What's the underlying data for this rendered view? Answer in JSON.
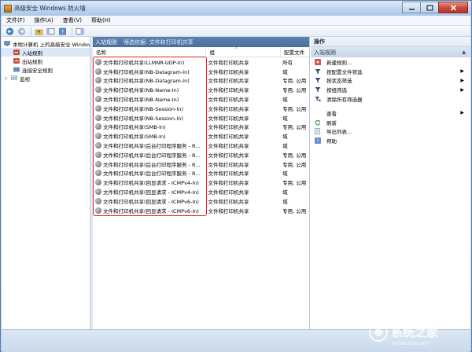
{
  "window": {
    "title": "高级安全 Windows 防火墙"
  },
  "menu": [
    "文件(F)",
    "操作(A)",
    "查看(V)",
    "帮助(H)"
  ],
  "tree": {
    "root": "本地计算机 上的高级安全 Windows 防火墙",
    "items": [
      "入站规则",
      "出站规则",
      "连接安全规则",
      "监视"
    ]
  },
  "center": {
    "title": "入站规则",
    "filter": "筛选依据: 文件和打印机共享",
    "columns": {
      "name": "名称",
      "group": "组",
      "profile": "配置文件"
    },
    "rows": [
      {
        "name": "文件和打印机共享(LLMNR-UDP-In)",
        "group": "文件和打印机共享",
        "profile": "所有"
      },
      {
        "name": "文件和打印机共享(NB-Datagram-In)",
        "group": "文件和打印机共享",
        "profile": "域"
      },
      {
        "name": "文件和打印机共享(NB-Datagram-In)",
        "group": "文件和打印机共享",
        "profile": "专用, 公用"
      },
      {
        "name": "文件和打印机共享(NB-Name-In)",
        "group": "文件和打印机共享",
        "profile": "专用, 公用"
      },
      {
        "name": "文件和打印机共享(NB-Name-In)",
        "group": "文件和打印机共享",
        "profile": "域"
      },
      {
        "name": "文件和打印机共享(NB-Session-In)",
        "group": "文件和打印机共享",
        "profile": "专用, 公用"
      },
      {
        "name": "文件和打印机共享(NB-Session-In)",
        "group": "文件和打印机共享",
        "profile": "域"
      },
      {
        "name": "文件和打印机共享(SMB-In)",
        "group": "文件和打印机共享",
        "profile": "专用, 公用"
      },
      {
        "name": "文件和打印机共享(SMB-In)",
        "group": "文件和打印机共享",
        "profile": "域"
      },
      {
        "name": "文件和打印机共享(后台打印程序服务 - R...",
        "group": "文件和打印机共享",
        "profile": "域"
      },
      {
        "name": "文件和打印机共享(后台打印程序服务 - R...",
        "group": "文件和打印机共享",
        "profile": "专用, 公用"
      },
      {
        "name": "文件和打印机共享(后台打印程序服务 - R...",
        "group": "文件和打印机共享",
        "profile": "专用, 公用"
      },
      {
        "name": "文件和打印机共享(后台打印程序服务 - R...",
        "group": "文件和打印机共享",
        "profile": "域"
      },
      {
        "name": "文件和打印机共享(回显请求 - ICMPv4-In)",
        "group": "文件和打印机共享",
        "profile": "专用, 公用"
      },
      {
        "name": "文件和打印机共享(回显请求 - ICMPv4-In)",
        "group": "文件和打印机共享",
        "profile": "域"
      },
      {
        "name": "文件和打印机共享(回显请求 - ICMPv6-In)",
        "group": "文件和打印机共享",
        "profile": "域"
      },
      {
        "name": "文件和打印机共享(回显请求 - ICMPv6-In)",
        "group": "文件和打印机共享",
        "profile": "专用, 公用"
      }
    ]
  },
  "actions": {
    "title": "操作",
    "section": "入站规则",
    "items": [
      {
        "label": "新建规则...",
        "icon": "new-rule-icon",
        "submenu": false
      },
      {
        "label": "按配置文件筛选",
        "icon": "filter-icon",
        "submenu": true
      },
      {
        "label": "按状态筛选",
        "icon": "filter-icon",
        "submenu": true
      },
      {
        "label": "按组筛选",
        "icon": "filter-icon",
        "submenu": true
      },
      {
        "label": "清除所有筛选器",
        "icon": "clear-filter-icon",
        "submenu": false
      },
      {
        "label": "查看",
        "icon": "",
        "submenu": true
      },
      {
        "label": "刷新",
        "icon": "refresh-icon",
        "submenu": false
      },
      {
        "label": "导出列表...",
        "icon": "export-icon",
        "submenu": false
      },
      {
        "label": "帮助",
        "icon": "help-icon",
        "submenu": false
      }
    ]
  },
  "watermark": {
    "text": "系统之家",
    "sub": "XITONGZHIJIA.NET"
  },
  "colors": {
    "highlight": "#e0242a",
    "header": "#4a6f9e"
  }
}
